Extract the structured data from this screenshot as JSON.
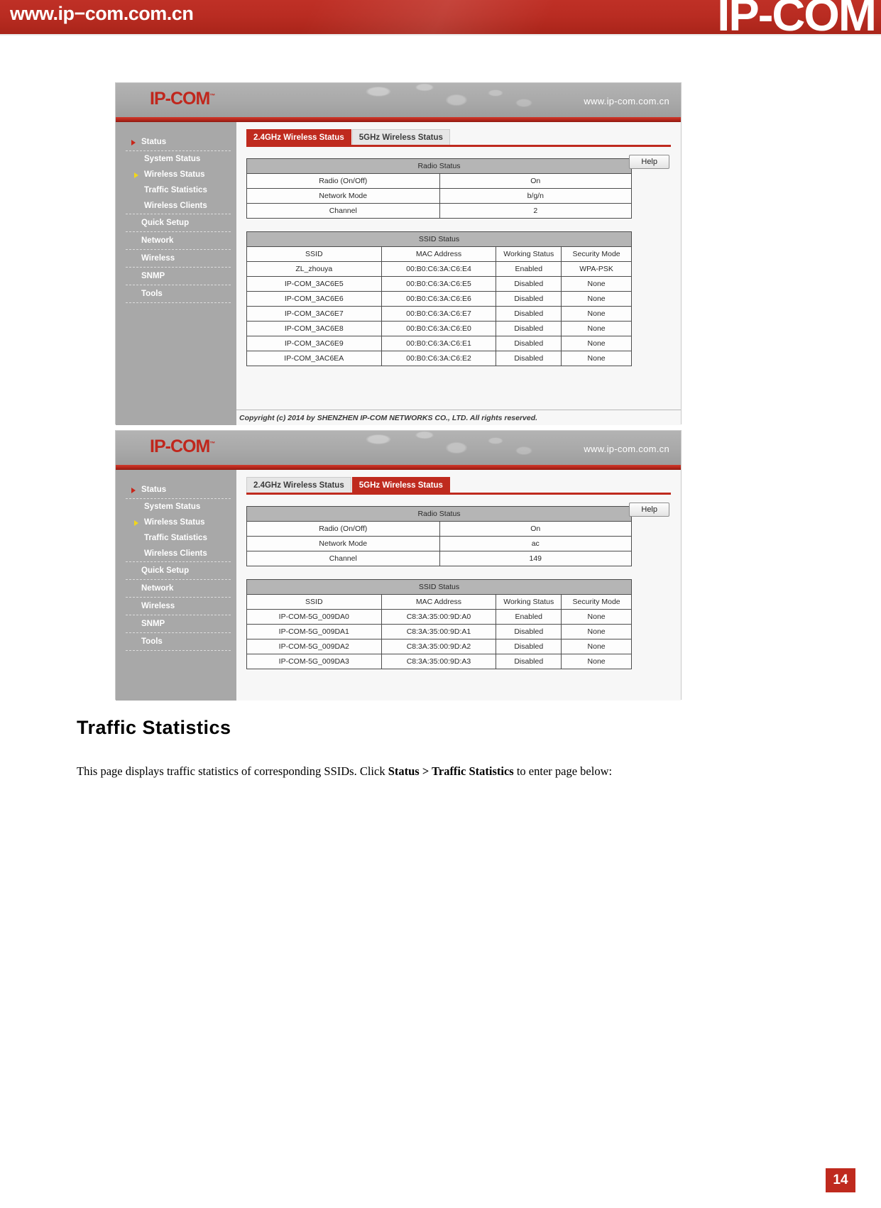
{
  "banner": {
    "url": "www.ip−com.com.cn",
    "logo": "IP-COM"
  },
  "ui_header": {
    "logo": "IP-COM",
    "trademark": "™",
    "url": "www.ip-com.com.cn"
  },
  "sidebar": {
    "items": [
      {
        "label": "Status",
        "type": "top",
        "arrow": "red-arrow-icon"
      },
      {
        "label": "System Status",
        "type": "sub",
        "arrow": null
      },
      {
        "label": "Wireless Status",
        "type": "sub",
        "arrow": "yellow-arrow-icon"
      },
      {
        "label": "Traffic Statistics",
        "type": "sub",
        "arrow": null
      },
      {
        "label": "Wireless Clients",
        "type": "sub-last",
        "arrow": null
      },
      {
        "label": "Quick Setup",
        "type": "top",
        "arrow": null
      },
      {
        "label": "Network",
        "type": "top",
        "arrow": null
      },
      {
        "label": "Wireless",
        "type": "top",
        "arrow": null
      },
      {
        "label": "SNMP",
        "type": "top",
        "arrow": null
      },
      {
        "label": "Tools",
        "type": "top-last",
        "arrow": null
      }
    ]
  },
  "shot1": {
    "tabs": [
      {
        "label": "2.4GHz Wireless Status",
        "active": true
      },
      {
        "label": "5GHz Wireless Status",
        "active": false
      }
    ],
    "help_label": "Help",
    "radio_status": {
      "caption": "Radio Status",
      "rows": [
        {
          "label": "Radio (On/Off)",
          "value": "On"
        },
        {
          "label": "Network Mode",
          "value": "b/g/n"
        },
        {
          "label": "Channel",
          "value": "2"
        }
      ]
    },
    "ssid_status": {
      "caption": "SSID Status",
      "columns": [
        "SSID",
        "MAC Address",
        "Working Status",
        "Security Mode"
      ],
      "rows": [
        [
          "ZL_zhouya",
          "00:B0:C6:3A:C6:E4",
          "Enabled",
          "WPA-PSK"
        ],
        [
          "IP-COM_3AC6E5",
          "00:B0:C6:3A:C6:E5",
          "Disabled",
          "None"
        ],
        [
          "IP-COM_3AC6E6",
          "00:B0:C6:3A:C6:E6",
          "Disabled",
          "None"
        ],
        [
          "IP-COM_3AC6E7",
          "00:B0:C6:3A:C6:E7",
          "Disabled",
          "None"
        ],
        [
          "IP-COM_3AC6E8",
          "00:B0:C6:3A:C6:E0",
          "Disabled",
          "None"
        ],
        [
          "IP-COM_3AC6E9",
          "00:B0:C6:3A:C6:E1",
          "Disabled",
          "None"
        ],
        [
          "IP-COM_3AC6EA",
          "00:B0:C6:3A:C6:E2",
          "Disabled",
          "None"
        ]
      ]
    },
    "copyright": "Copyright (c) 2014 by SHENZHEN IP-COM NETWORKS CO., LTD. All rights reserved."
  },
  "shot2": {
    "tabs": [
      {
        "label": "2.4GHz Wireless Status",
        "active": false
      },
      {
        "label": "5GHz Wireless Status",
        "active": true
      }
    ],
    "help_label": "Help",
    "radio_status": {
      "caption": "Radio Status",
      "rows": [
        {
          "label": "Radio (On/Off)",
          "value": "On"
        },
        {
          "label": "Network Mode",
          "value": "ac"
        },
        {
          "label": "Channel",
          "value": "149"
        }
      ]
    },
    "ssid_status": {
      "caption": "SSID Status",
      "columns": [
        "SSID",
        "MAC Address",
        "Working Status",
        "Security Mode"
      ],
      "rows": [
        [
          "IP-COM-5G_009DA0",
          "C8:3A:35:00:9D:A0",
          "Enabled",
          "None"
        ],
        [
          "IP-COM-5G_009DA1",
          "C8:3A:35:00:9D:A1",
          "Disabled",
          "None"
        ],
        [
          "IP-COM-5G_009DA2",
          "C8:3A:35:00:9D:A2",
          "Disabled",
          "None"
        ],
        [
          "IP-COM-5G_009DA3",
          "C8:3A:35:00:9D:A3",
          "Disabled",
          "None"
        ]
      ]
    }
  },
  "document": {
    "heading": "Traffic Statistics",
    "paragraph_part1": "This page displays traffic statistics of corresponding SSIDs. Click ",
    "paragraph_bold": "Status > Traffic Statistics",
    "paragraph_part2": " to enter page below:",
    "page_number": "14"
  },
  "colors": {
    "brand_red": "#bf2a1e",
    "banner_red": "#b92c22",
    "sidebar_gray": "#a8a8a8",
    "table_caption_gray": "#b5b5b5"
  }
}
